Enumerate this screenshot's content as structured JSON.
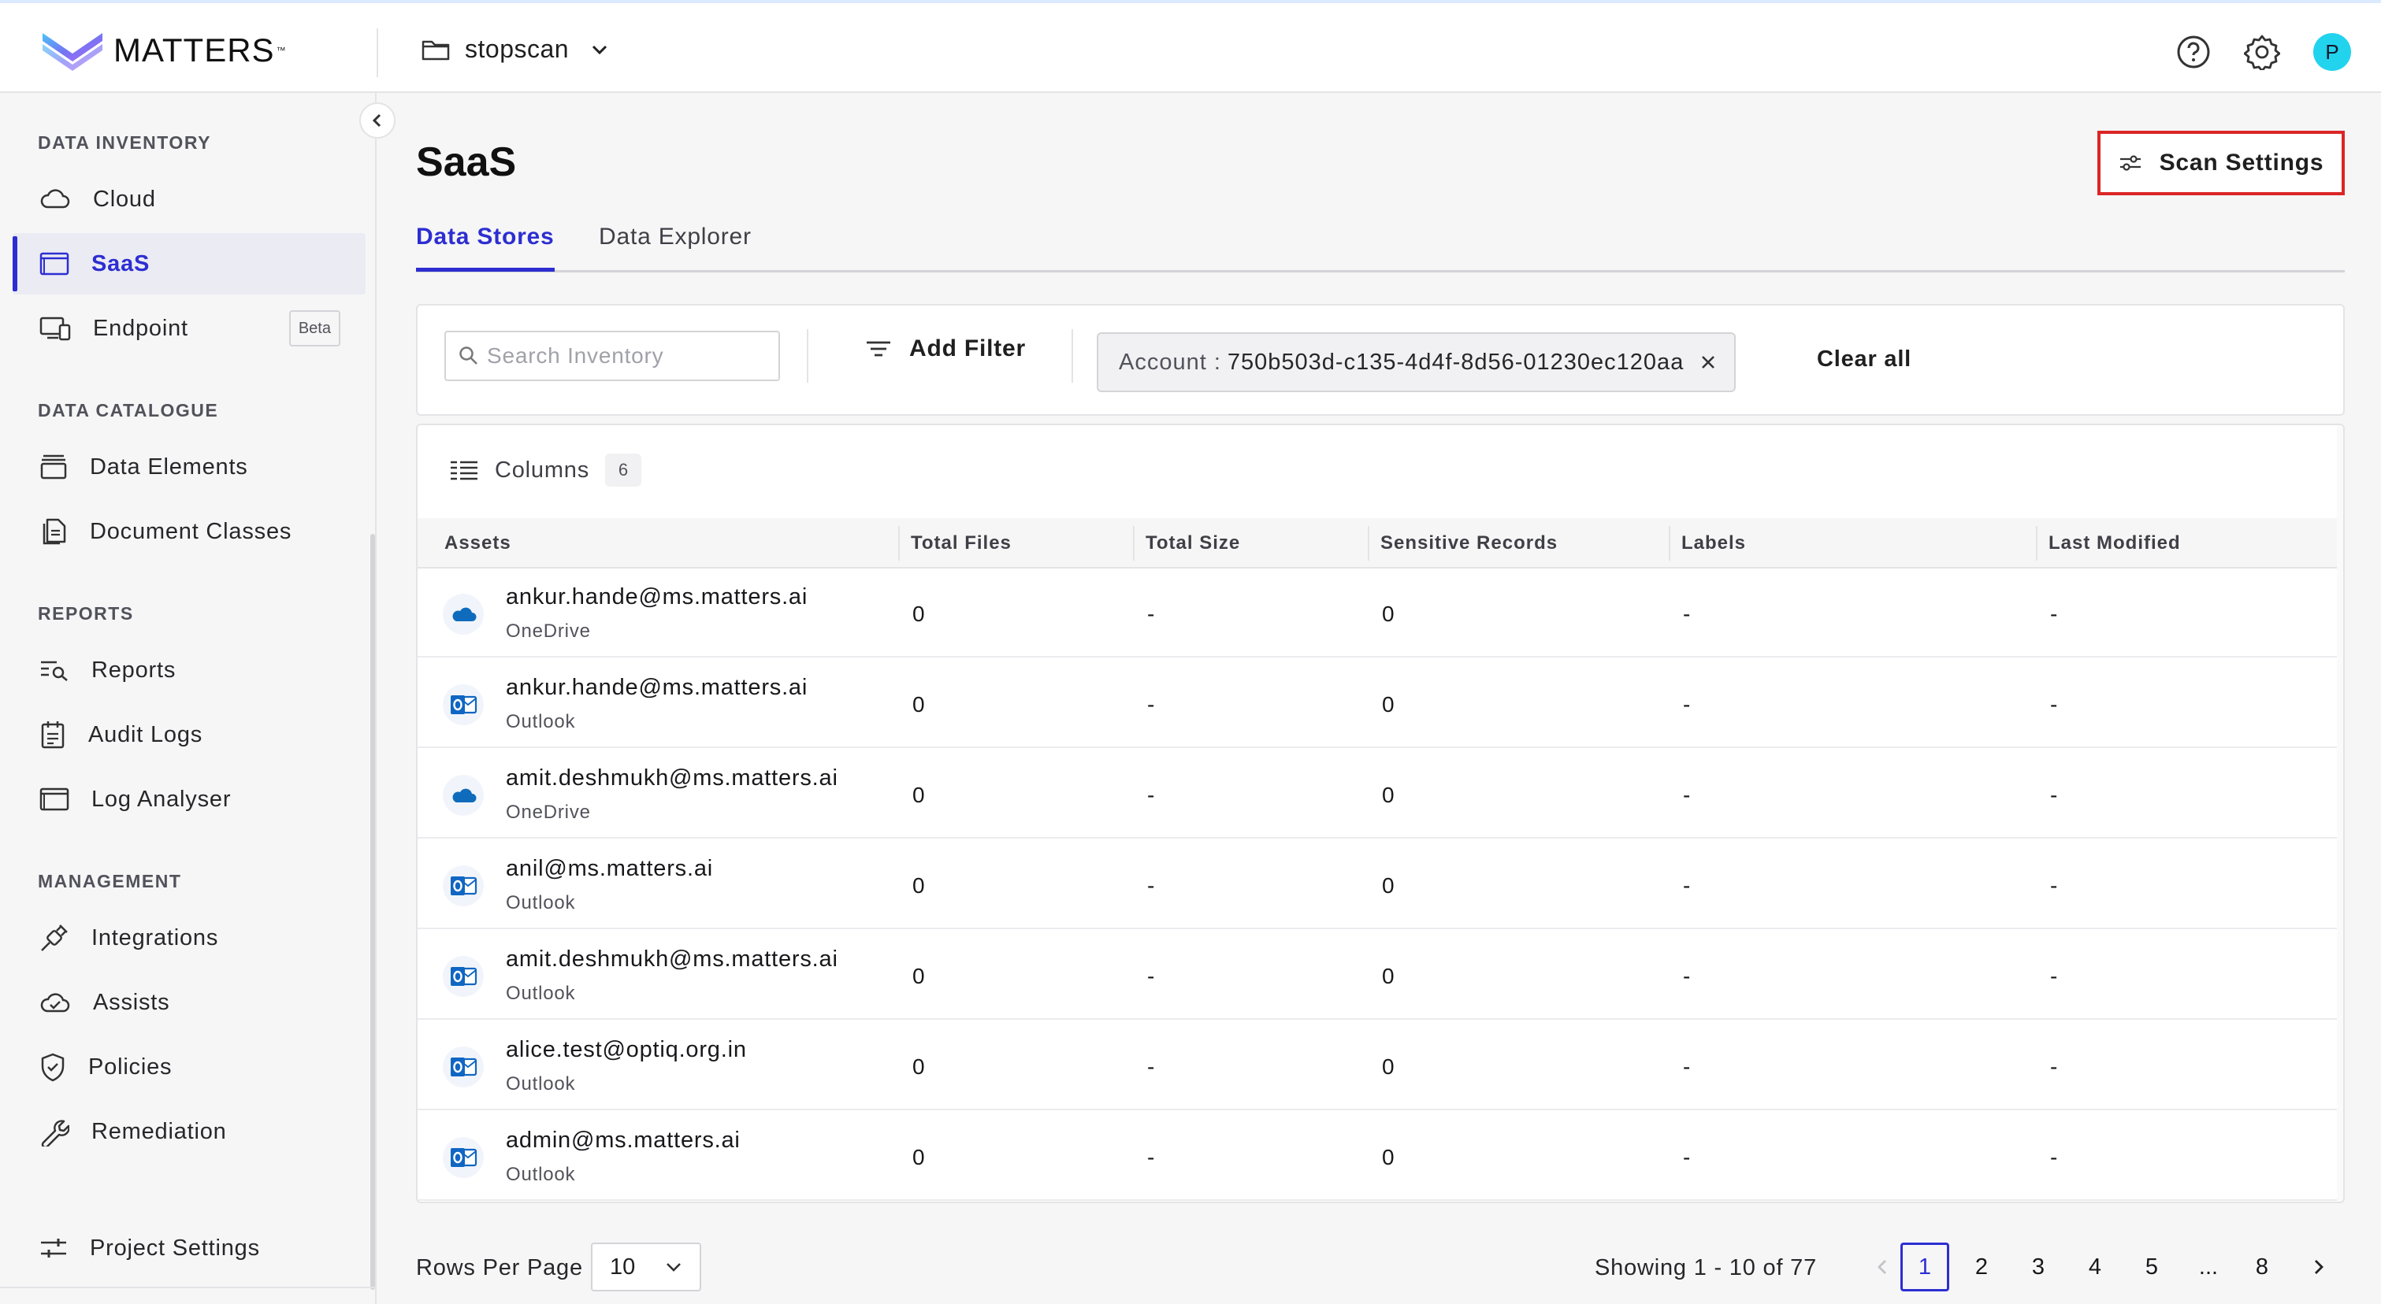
{
  "header": {
    "logo_text": "MATTERS",
    "logo_tm": "™",
    "project": "stopscan",
    "avatar_initial": "P"
  },
  "sidebar": {
    "sections": [
      {
        "title": "DATA INVENTORY",
        "items": [
          {
            "label": "Cloud",
            "icon": "cloud-icon"
          },
          {
            "label": "SaaS",
            "icon": "window-icon",
            "active": true
          },
          {
            "label": "Endpoint",
            "icon": "devices-icon",
            "badge": "Beta"
          }
        ]
      },
      {
        "title": "DATA CATALOGUE",
        "items": [
          {
            "label": "Data Elements",
            "icon": "database-icon"
          },
          {
            "label": "Document Classes",
            "icon": "documents-icon"
          }
        ]
      },
      {
        "title": "REPORTS",
        "items": [
          {
            "label": "Reports",
            "icon": "report-search-icon"
          },
          {
            "label": "Audit Logs",
            "icon": "calendar-list-icon"
          },
          {
            "label": "Log Analyser",
            "icon": "window-icon"
          }
        ]
      },
      {
        "title": "MANAGEMENT",
        "items": [
          {
            "label": "Integrations",
            "icon": "plug-icon"
          },
          {
            "label": "Assists",
            "icon": "cloud-check-icon"
          },
          {
            "label": "Policies",
            "icon": "shield-check-icon"
          },
          {
            "label": "Remediation",
            "icon": "wrench-icon"
          }
        ]
      }
    ],
    "footer_item": {
      "label": "Project Settings",
      "icon": "sliders-icon"
    }
  },
  "main": {
    "title": "SaaS",
    "scan_settings_label": "Scan Settings",
    "tabs": [
      {
        "label": "Data Stores",
        "active": true
      },
      {
        "label": "Data Explorer",
        "active": false
      }
    ],
    "search_placeholder": "Search Inventory",
    "add_filter_label": "Add Filter",
    "filter_chip": {
      "key": "Account :",
      "value": "750b503d-c135-4d4f-8d56-01230ec120aa"
    },
    "clear_all_label": "Clear all",
    "columns_label": "Columns",
    "columns_count": "6"
  },
  "table": {
    "headers": [
      "Assets",
      "Total Files",
      "Total Size",
      "Sensitive Records",
      "Labels",
      "Last Modified"
    ],
    "rows": [
      {
        "name": "ankur.hande@ms.matters.ai",
        "type": "OneDrive",
        "icon": "onedrive-icon",
        "total_files": "0",
        "total_size": "-",
        "sensitive_records": "0",
        "labels": "-",
        "last_modified": "-"
      },
      {
        "name": "ankur.hande@ms.matters.ai",
        "type": "Outlook",
        "icon": "outlook-icon",
        "total_files": "0",
        "total_size": "-",
        "sensitive_records": "0",
        "labels": "-",
        "last_modified": "-"
      },
      {
        "name": "amit.deshmukh@ms.matters.ai",
        "type": "OneDrive",
        "icon": "onedrive-icon",
        "total_files": "0",
        "total_size": "-",
        "sensitive_records": "0",
        "labels": "-",
        "last_modified": "-"
      },
      {
        "name": "anil@ms.matters.ai",
        "type": "Outlook",
        "icon": "outlook-icon",
        "total_files": "0",
        "total_size": "-",
        "sensitive_records": "0",
        "labels": "-",
        "last_modified": "-"
      },
      {
        "name": "amit.deshmukh@ms.matters.ai",
        "type": "Outlook",
        "icon": "outlook-icon",
        "total_files": "0",
        "total_size": "-",
        "sensitive_records": "0",
        "labels": "-",
        "last_modified": "-"
      },
      {
        "name": "alice.test@optiq.org.in",
        "type": "Outlook",
        "icon": "outlook-icon",
        "total_files": "0",
        "total_size": "-",
        "sensitive_records": "0",
        "labels": "-",
        "last_modified": "-"
      },
      {
        "name": "admin@ms.matters.ai",
        "type": "Outlook",
        "icon": "outlook-icon",
        "total_files": "0",
        "total_size": "-",
        "sensitive_records": "0",
        "labels": "-",
        "last_modified": "-"
      }
    ]
  },
  "pagination": {
    "rows_per_page_label": "Rows Per Page",
    "rows_per_page_value": "10",
    "showing": "Showing 1 - 10 of 77",
    "pages": [
      "1",
      "2",
      "3",
      "4",
      "5",
      "...",
      "8"
    ],
    "current_page": "1"
  },
  "colors": {
    "accent": "#2d2ed1",
    "highlight_border": "#dc2626",
    "avatar": "#22d3ee",
    "onedrive": "#0f6cbd",
    "outlook": "#1066c2"
  }
}
